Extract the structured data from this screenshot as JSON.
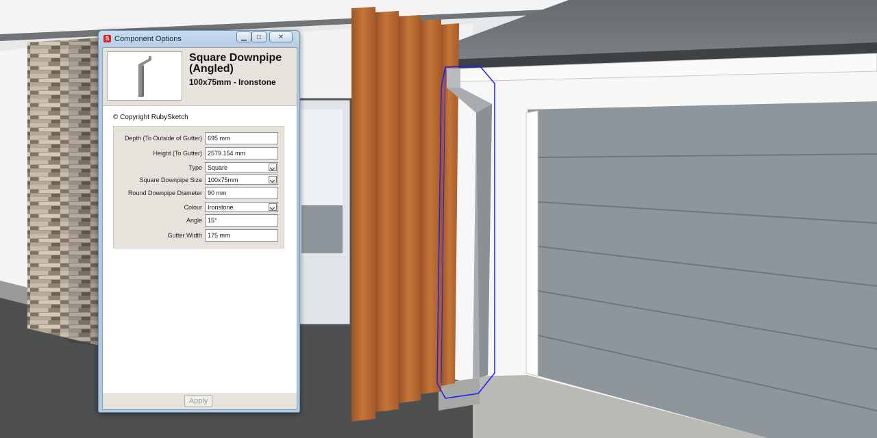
{
  "dialog": {
    "title": "Component Options",
    "app_icon": "sketchup-icon",
    "window_buttons": {
      "minimize": "minimize-icon",
      "maximize": "maximize-icon",
      "close": "close-icon"
    }
  },
  "component": {
    "title": "Square Downpipe (Angled)",
    "subtitle": "100x75mm - Ironstone",
    "copyright": "© Copyright RubySketch"
  },
  "form": {
    "depth": {
      "label": "Depth (To Outside of Gutter)",
      "value": "695 mm"
    },
    "height": {
      "label": "Height (To Gutter)",
      "value": "2579.154 mm"
    },
    "type": {
      "label": "Type",
      "value": "Square"
    },
    "size": {
      "label": "Square Downpipe Size",
      "value": "100x75mm"
    },
    "diameter": {
      "label": "Round Downpipe Diameter",
      "value": "90 mm"
    },
    "colour": {
      "label": "Colour",
      "value": "Ironstone"
    },
    "angle": {
      "label": "Angle",
      "value": "15°"
    },
    "gutter_width": {
      "label": "Gutter Width",
      "value": "175 mm"
    }
  },
  "footer": {
    "apply_label": "Apply"
  },
  "colors": {
    "timber": "#b5652e",
    "selection": "#1b1bff",
    "garage_door": "#8f969b",
    "roof": "#6d7377"
  }
}
